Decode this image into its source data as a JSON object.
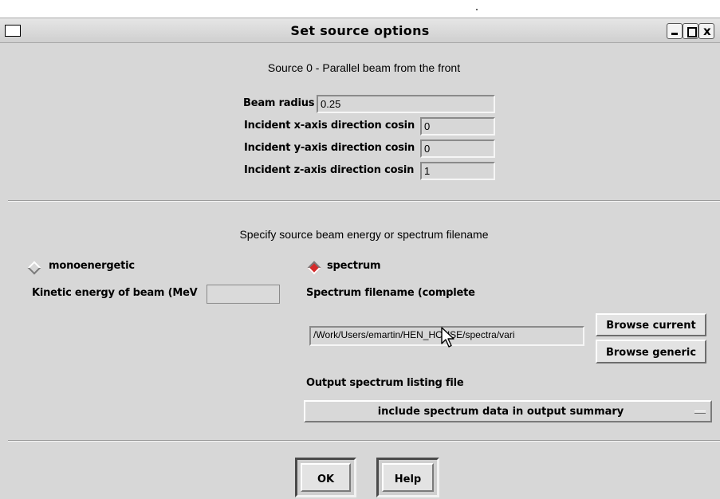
{
  "window": {
    "title": "Set source options"
  },
  "source": {
    "caption": "Source 0 - Parallel beam from the front",
    "fields": [
      {
        "label": "Beam radius",
        "value": "0.25"
      },
      {
        "label": "Incident x-axis direction cosin",
        "value": "0"
      },
      {
        "label": "Incident y-axis direction cosin",
        "value": "0"
      },
      {
        "label": "Incident z-axis direction cosin",
        "value": "1"
      }
    ]
  },
  "energy": {
    "caption": "Specify source beam energy or spectrum filename",
    "mono_label": "monoenergetic",
    "spectrum_label": "spectrum",
    "selected": "spectrum",
    "kinetic_label": "Kinetic energy of beam (MeV",
    "kinetic_value": "",
    "spectrum_file_label": "Spectrum filename (complete",
    "spectrum_file_value": "/Work/Users/emartin/HEN_HOUSE/spectra/vari",
    "browse_current": "Browse current",
    "browse_generic": "Browse generic",
    "output_label": "Output spectrum listing file",
    "output_option": "include spectrum data in output summary"
  },
  "buttons": {
    "ok": "OK",
    "help": "Help"
  }
}
